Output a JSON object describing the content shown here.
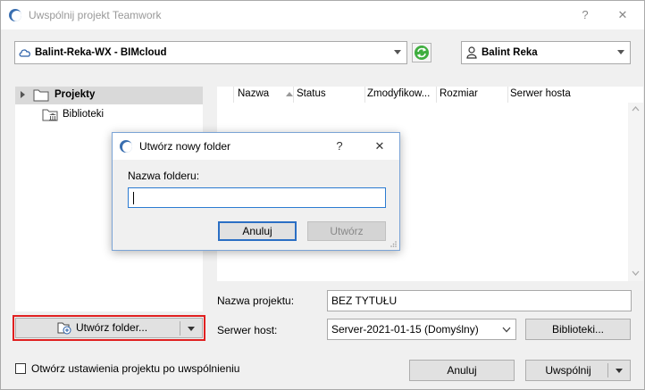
{
  "window": {
    "title": "Uwspólnij projekt Teamwork",
    "help_glyph": "?",
    "close_glyph": "✕"
  },
  "server_combo": {
    "label": "Balint-Reka-WX - BIMcloud"
  },
  "user_combo": {
    "label": "Balint Reka"
  },
  "tree": {
    "items": [
      {
        "label": "Projekty",
        "selected": true
      },
      {
        "label": "Biblioteki",
        "selected": false
      }
    ]
  },
  "list": {
    "columns": [
      "Nazwa",
      "Status",
      "Zmodyfikow...",
      "Rozmiar",
      "Serwer hosta"
    ]
  },
  "form": {
    "project_name_label": "Nazwa projektu:",
    "project_name_value": "BEZ TYTUŁU",
    "server_host_label": "Serwer host:",
    "server_host_value": "Server-2021-01-15 (Domyślny)",
    "libraries_button": "Biblioteki..."
  },
  "create_folder_button": "Utwórz folder...",
  "open_settings_label": "Otwórz ustawienia projektu po uwspólnieniu",
  "footer": {
    "cancel": "Anuluj",
    "share": "Uwspólnij"
  },
  "dialog": {
    "title": "Utwórz nowy folder",
    "help_glyph": "?",
    "close_glyph": "✕",
    "field_label": "Nazwa folderu:",
    "field_value": "",
    "cancel": "Anuluj",
    "create": "Utwórz"
  }
}
